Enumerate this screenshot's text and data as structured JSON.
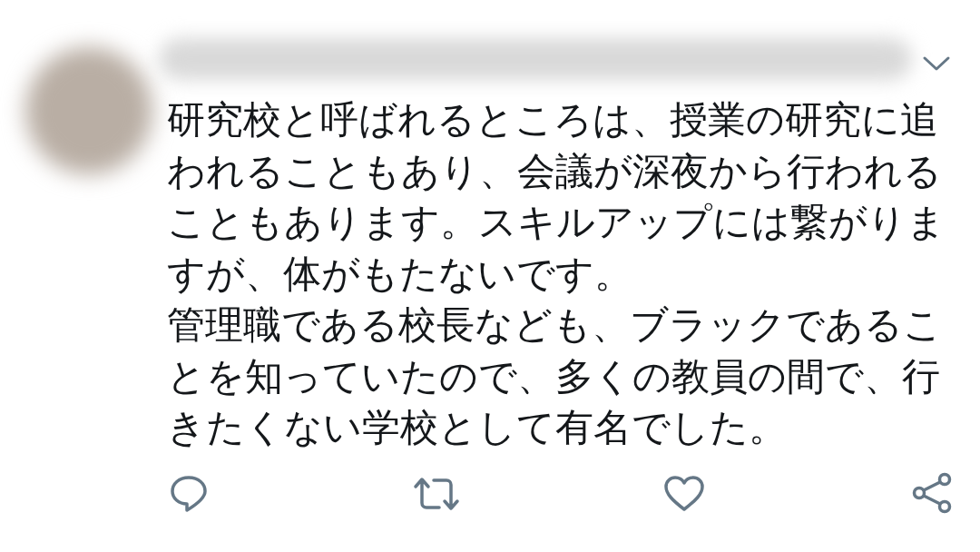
{
  "tweet": {
    "paragraphs": [
      "研究校と呼ばれるところは、授業の研究に追われることもあり、会議が深夜から行われることもあります。スキルアップには繋がりますが、体がもたないです。",
      "管理職である校長なども、ブラックであることを知っていたので、多くの教員の間で、行きたくない学校として有名でした。"
    ]
  }
}
